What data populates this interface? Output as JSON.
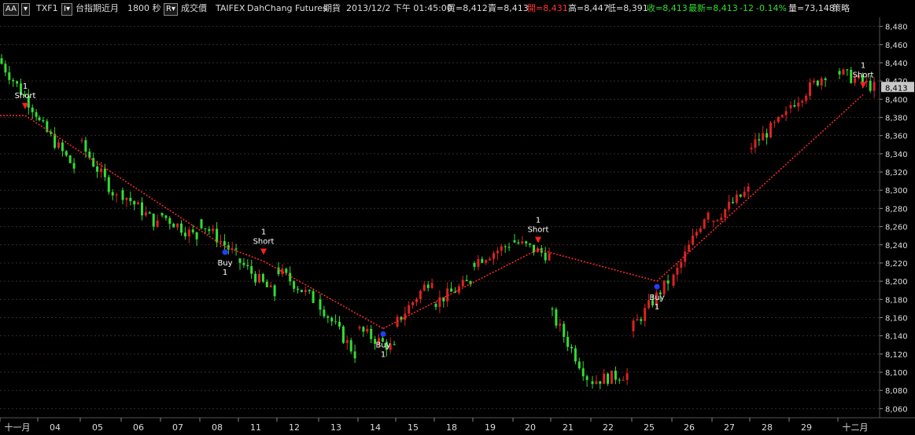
{
  "header": {
    "aa_button": "AA",
    "aa_dropdown": "▾",
    "symbol": "TXF1",
    "symbol_button": "I▾",
    "name": "台指期近月",
    "interval": "1800 秒",
    "r_button": "R▾",
    "field": "成交價",
    "exchange": "TAIFEX",
    "broker": "DahChang Futures",
    "category": "期貨",
    "datetime": "2013/12/2  下午 01:45:00",
    "bid": "買=8,412",
    "ask": "賣=8,413",
    "open": "開=8,431",
    "high": "高=8,447",
    "low": "低=8,391",
    "close": "收=8,413",
    "last": "最新=8,413",
    "change": "-12",
    "change_pct": "-0.14%",
    "volume": "量=73,148",
    "strategy": "策略"
  },
  "colors": {
    "up": "#dd2222",
    "down": "#33dd33",
    "signal_line": "#ff2a2a",
    "buy_marker": "#1f3fff",
    "short_marker": "#ff2020",
    "grid": "#3a2a2a",
    "price_tag_bg": "#c8c8c8"
  },
  "chart_data": {
    "type": "candlestick",
    "symbol": "TXF1",
    "ylim": [
      8050,
      8490
    ],
    "y_ticks": [
      "8,060",
      "8,080",
      "8,100",
      "8,120",
      "8,140",
      "8,160",
      "8,180",
      "8,200",
      "8,220",
      "8,240",
      "8,260",
      "8,280",
      "8,300",
      "8,320",
      "8,340",
      "8,360",
      "8,380",
      "8,400",
      "8,420",
      "8,440",
      "8,460",
      "8,480"
    ],
    "last_price_label": "8,413",
    "last_price": 8413,
    "x_labels": [
      "十一月",
      "04",
      "05",
      "06",
      "07",
      "08",
      "11",
      "12",
      "13",
      "14",
      "15",
      "18",
      "19",
      "20",
      "21",
      "22",
      "25",
      "26",
      "27",
      "28",
      "29",
      "十二月"
    ],
    "sessions": [
      {
        "label": "十一月",
        "open": 8445,
        "close": 8385,
        "high": 8478,
        "low": 8375
      },
      {
        "label": "04",
        "open": 8380,
        "close": 8325,
        "high": 8395,
        "low": 8308
      },
      {
        "label": "05",
        "open": 8355,
        "close": 8292,
        "high": 8362,
        "low": 8280
      },
      {
        "label": "06",
        "open": 8300,
        "close": 8262,
        "high": 8305,
        "low": 8248
      },
      {
        "label": "07",
        "open": 8275,
        "close": 8248,
        "high": 8285,
        "low": 8232
      },
      {
        "label": "08",
        "open": 8268,
        "close": 8228,
        "high": 8272,
        "low": 8215
      },
      {
        "label": "11",
        "open": 8225,
        "close": 8185,
        "high": 8238,
        "low": 8178
      },
      {
        "label": "12",
        "open": 8215,
        "close": 8180,
        "high": 8232,
        "low": 8170
      },
      {
        "label": "13",
        "open": 8180,
        "close": 8120,
        "high": 8188,
        "low": 8108
      },
      {
        "label": "14",
        "open": 8148,
        "close": 8125,
        "high": 8152,
        "low": 8090
      },
      {
        "label": "15",
        "open": 8150,
        "close": 8205,
        "high": 8212,
        "low": 8145
      },
      {
        "label": "18",
        "open": 8175,
        "close": 8200,
        "high": 8218,
        "low": 8165
      },
      {
        "label": "19",
        "open": 8220,
        "close": 8240,
        "high": 8258,
        "low": 8212
      },
      {
        "label": "20",
        "open": 8245,
        "close": 8228,
        "high": 8260,
        "low": 8218
      },
      {
        "label": "21",
        "open": 8170,
        "close": 8095,
        "high": 8172,
        "low": 8075
      },
      {
        "label": "22",
        "open": 8090,
        "close": 8098,
        "high": 8110,
        "low": 8070
      },
      {
        "label": "25",
        "open": 8145,
        "close": 8200,
        "high": 8210,
        "low": 8138
      },
      {
        "label": "26",
        "open": 8195,
        "close": 8280,
        "high": 8285,
        "low": 8158
      },
      {
        "label": "27",
        "open": 8265,
        "close": 8300,
        "high": 8308,
        "low": 8228
      },
      {
        "label": "28",
        "open": 8345,
        "close": 8382,
        "high": 8392,
        "low": 8340
      },
      {
        "label": "29",
        "open": 8390,
        "close": 8428,
        "high": 8440,
        "low": 8383
      },
      {
        "label": "十二月",
        "open": 8431,
        "close": 8413,
        "high": 8447,
        "low": 8391
      }
    ],
    "signals": [
      {
        "type": "short",
        "label": "Short",
        "qty": "1",
        "session": 0,
        "price": 8382
      },
      {
        "type": "buy",
        "label": "Buy",
        "qty": "1",
        "session": 5,
        "price": 8238
      },
      {
        "type": "short",
        "label": "Short",
        "qty": "1",
        "session": 6,
        "price": 8222
      },
      {
        "type": "buy",
        "label": "Buy",
        "qty": "1",
        "session": 9,
        "price": 8148
      },
      {
        "type": "short",
        "label": "Short",
        "qty": "1",
        "session": 13,
        "price": 8235
      },
      {
        "type": "buy",
        "label": "Buy",
        "qty": "1",
        "session": 16,
        "price": 8200
      },
      {
        "type": "short",
        "label": "Short",
        "qty": "1",
        "session": 21,
        "price": 8405
      }
    ],
    "position_line": [
      {
        "session": 0,
        "price": 8382
      },
      {
        "session": 5,
        "price": 8238
      },
      {
        "session": 6,
        "price": 8222
      },
      {
        "session": 9,
        "price": 8148
      },
      {
        "session": 13,
        "price": 8235
      },
      {
        "session": 16,
        "price": 8200
      },
      {
        "session": 21,
        "price": 8405
      }
    ],
    "pre_line_price": 8382
  }
}
